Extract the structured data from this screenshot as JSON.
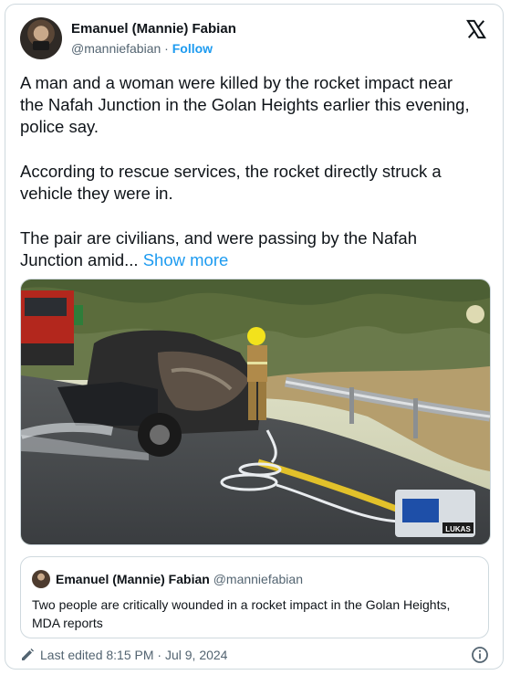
{
  "author": {
    "name": "Emanuel (Mannie) Fabian",
    "handle": "@manniefabian",
    "separator": "·",
    "follow_label": "Follow"
  },
  "tweet": {
    "paragraphs": [
      "A man and a woman were killed by the rocket impact near the Nafah Junction in the Golan Heights earlier this evening, police say.",
      "According to rescue services, the rocket directly struck a vehicle they were in."
    ],
    "last_paragraph": "The pair are civilians, and were passing by the Nafah Junction amid...",
    "show_more": "Show more"
  },
  "photo": {
    "equipment_label": "LUKAS"
  },
  "quoted": {
    "name": "Emanuel (Mannie) Fabian",
    "handle": "@manniefabian",
    "text": "Two people are critically wounded in a rocket impact in the Golan Heights, MDA reports"
  },
  "footer": {
    "edited_text": "Last edited 8:15 PM · Jul 9, 2024"
  },
  "icons": {
    "brand": "x-logo-icon",
    "edit": "pencil-icon",
    "info": "info-icon"
  }
}
